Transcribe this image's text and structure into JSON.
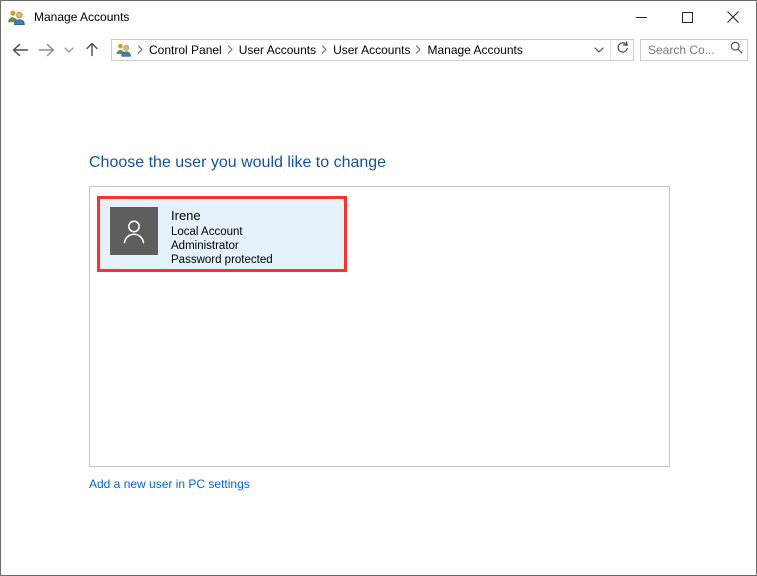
{
  "window": {
    "title": "Manage Accounts",
    "title_icon": "user-accounts-icon",
    "controls": {
      "minimize_label": "Minimize",
      "maximize_label": "Maximize",
      "close_label": "Close"
    }
  },
  "navbar": {
    "back_label": "Back",
    "forward_label": "Forward",
    "recent_label": "Recent locations",
    "up_label": "Up one level",
    "address_icon": "user-accounts-icon",
    "breadcrumbs": [
      "Control Panel",
      "User Accounts",
      "User Accounts",
      "Manage Accounts"
    ],
    "separator": "›",
    "dropdown_label": "Previous locations",
    "refresh_label": "Refresh"
  },
  "search": {
    "placeholder": "Search Co...",
    "icon": "search-icon"
  },
  "main": {
    "heading": "Choose the user you would like to change",
    "accounts": [
      {
        "name": "Irene",
        "account_type": "Local Account",
        "role": "Administrator",
        "password_status": "Password protected",
        "avatar_icon": "person-icon",
        "selected": true
      }
    ],
    "add_user_link": "Add a new user in PC settings"
  },
  "colors": {
    "heading_blue": "#14519e",
    "link_blue": "#0066cc",
    "highlight_red": "#f2352e",
    "card_selected_bg": "#e5f1fb",
    "avatar_gray": "#5e5e5e",
    "panel_border": "#c4c4c4"
  }
}
